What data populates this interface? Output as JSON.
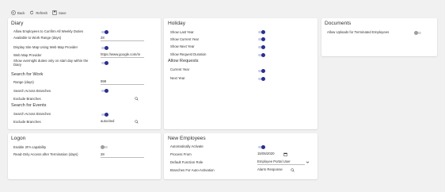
{
  "toolbar": {
    "back_label": "Back",
    "refresh_label": "Refresh",
    "save_label": "Save"
  },
  "diary": {
    "title": "Diary",
    "rows": {
      "allow_confirm": "Allow Employees to Confirm All Weekly Duties",
      "available_range": "Available to Work Range (days)",
      "display_site_map": "Display Site Map Using Web Map Provider",
      "web_map_provider": "Web Map Provider",
      "show_overnight": "Show overnight duties only on start day within the Diary"
    },
    "values": {
      "available_range": "28",
      "web_map_provider": "https://www.google.com/m"
    },
    "search_work": {
      "title": "Search for Work",
      "range_label": "Range (days)",
      "range_value": "999",
      "across_branches": "Search Across Branches",
      "exclude_branches": "Exclude Branches"
    },
    "search_events": {
      "title": "Search for Events",
      "across_branches": "Search Across Branches",
      "exclude_branches": "Exclude Branches",
      "exclude_value": "autocited"
    }
  },
  "holiday": {
    "title": "Holiday",
    "rows": {
      "show_last_year": "Show Last Year",
      "show_current_year": "Show Current Year",
      "show_next_year": "Show Next Year",
      "show_request_duration": "Show Request Duration"
    },
    "allow_requests": {
      "title": "Allow Requests",
      "current_year": "Current Year",
      "next_year": "Next Year"
    }
  },
  "documents": {
    "title": "Documents",
    "allow_uploads": "Allow Uploads for Terminated Employees"
  },
  "logon": {
    "title": "Logon",
    "enable_2fa": "Enable 2FA capability",
    "readonly_access": "Read-Only Access after Termination (days)",
    "readonly_value": "28"
  },
  "new_employees": {
    "title": "New Employees",
    "auto_activate": "Automatically Activate",
    "process_from": "Process From",
    "process_from_value": "15/05/2020",
    "default_role": "Default Function Role",
    "default_role_value": "Employee Portal User",
    "branches_auto": "Branches For Auto-Activation",
    "branches_value": "Alarm Response"
  },
  "colors": {
    "toggle_on_knob": "#2b2f8f",
    "toggle_on_track": "#c7cde6",
    "toggle_off_knob": "#9e9e9e",
    "toggle_off_track": "#d7d7d7"
  }
}
